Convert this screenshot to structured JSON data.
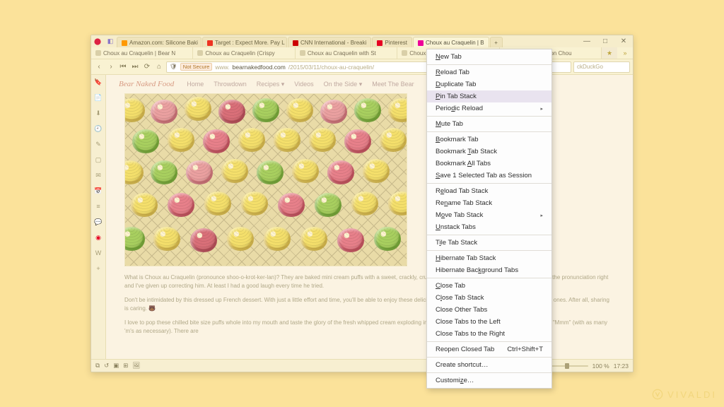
{
  "window": {
    "minimize": "—",
    "maximize": "□",
    "close": "✕"
  },
  "top_tabs": [
    {
      "label": "Amazon.com: Silicone Baki"
    },
    {
      "label": "Target : Expect More. Pay L"
    },
    {
      "label": "CNN International - Breaki"
    },
    {
      "label": "Pinterest"
    },
    {
      "label": "Choux au Craquelin | B"
    }
  ],
  "sub_tabs": [
    {
      "label": "Choux au Craquelin | Bear N"
    },
    {
      "label": "Choux au Craquelin (Crispy"
    },
    {
      "label": "Choux au Craquelin with St"
    },
    {
      "label": "Choux Craquelin – Tradition"
    },
    {
      "label": "How Craquelin on Chou"
    }
  ],
  "toolbar": {
    "not_secure": "Not Secure",
    "url_prefix": "www.",
    "url_host": "bearnakedfood.com",
    "url_path": "/2015/03/11/choux-au-craquelin/",
    "search_placeholder": "ckDuckGo"
  },
  "site": {
    "logo": "Bear Naked Food",
    "nav": [
      "Home",
      "Throwdown",
      "Recipes ▾",
      "Videos",
      "On the Side ▾",
      "Meet The Bear"
    ],
    "p1": "What is Choux au Craquelin (pronounce shoo-o-krot-ker-lan)? They are baked mini cream puffs with a sweet, crackly, crunchy topping. Tiger (aka hubby) just could not get the pronunciation right and I've given up correcting him. At least I had a good laugh every time he tried.",
    "p2": "Don't be intimidated by this dressed up French dessert. With just a little effort and time, you'll be able to enjoy these delicious treats all by yourself… I mean with your loved ones. After all, sharing is caring. 🐻",
    "p3": "I love to pop these chilled bite size puffs whole into my mouth and taste the glory of the fresh whipped cream exploding in my mouth. The only vocabulary I could think of is \"Mmm\" (with as many 'm's as necessary). There are"
  },
  "context_menu": {
    "new_tab": "New Tab",
    "reload_tab": "Reload Tab",
    "duplicate_tab": "Duplicate Tab",
    "pin_tab_stack": "Pin Tab Stack",
    "periodic_reload": "Periodic Reload",
    "mute_tab": "Mute Tab",
    "bookmark_tab": "Bookmark Tab",
    "bookmark_tab_stack": "Bookmark Tab Stack",
    "bookmark_all_tabs": "Bookmark All Tabs",
    "save_session": "Save 1 Selected Tab as Session",
    "reload_tab_stack": "Reload Tab Stack",
    "rename_tab_stack": "Rename Tab Stack",
    "move_tab_stack": "Move Tab Stack",
    "unstack_tabs": "Unstack Tabs",
    "tile_tab_stack": "Tile Tab Stack",
    "hibernate_tab_stack": "Hibernate Tab Stack",
    "hibernate_background": "Hibernate Background Tabs",
    "close_tab": "Close Tab",
    "close_tab_stack": "Close Tab Stack",
    "close_other_tabs": "Close Other Tabs",
    "close_left": "Close Tabs to the Left",
    "close_right": "Close Tabs to the Right",
    "reopen_closed": "Reopen Closed Tab",
    "reopen_shortcut": "Ctrl+Shift+T",
    "create_shortcut": "Create shortcut…",
    "customize": "Customize…"
  },
  "status": {
    "zoom": "100 %",
    "time": "17:23"
  },
  "watermark": "VIVALDI"
}
